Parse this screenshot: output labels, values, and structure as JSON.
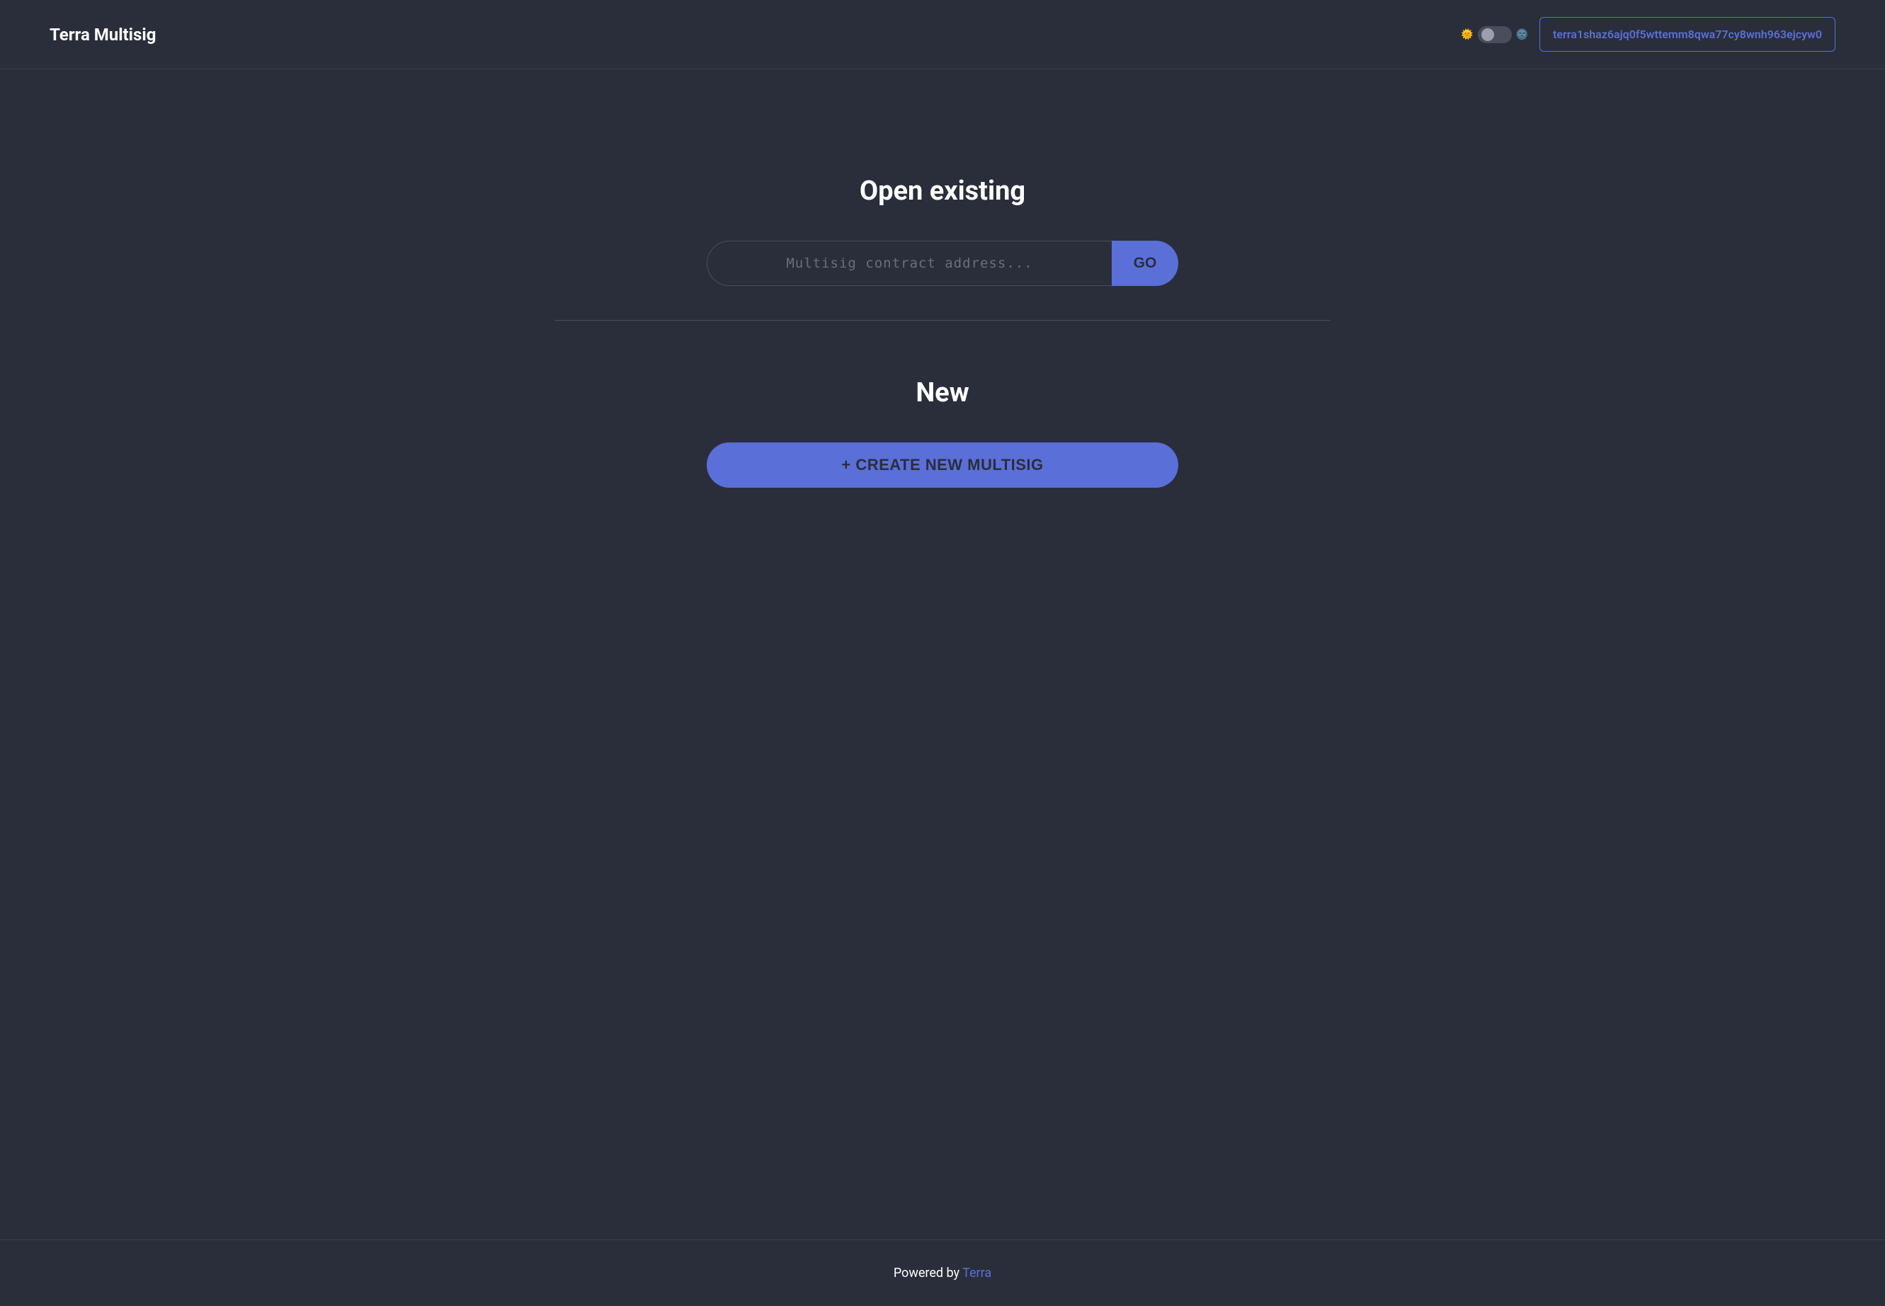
{
  "header": {
    "title": "Terra Multisig",
    "theme": {
      "light_emoji": "🌞",
      "dark_emoji": "🌚"
    },
    "wallet_address": "terra1shaz6ajq0f5wttemm8qwa77cy8wnh963ejcyw0"
  },
  "main": {
    "open_existing": {
      "title": "Open existing",
      "input_placeholder": "Multisig contract address...",
      "go_label": "GO"
    },
    "new": {
      "title": "New",
      "create_label": "+ CREATE NEW MULTISIG"
    }
  },
  "footer": {
    "text_prefix": "Powered by ",
    "link_label": "Terra"
  }
}
